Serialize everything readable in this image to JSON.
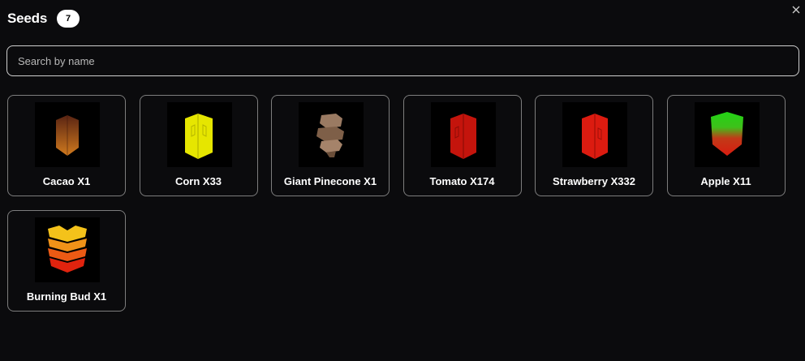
{
  "header": {
    "title": "Seeds",
    "count": "7"
  },
  "search": {
    "placeholder": "Search by name",
    "value": ""
  },
  "close_icon": "close-icon",
  "colors": {
    "background": "#0b0b0d",
    "card_border": "#7d7d7d",
    "badge_bg": "#ffffff"
  },
  "seeds": [
    {
      "label": "Cacao X1",
      "icon": "cacao-seed-icon"
    },
    {
      "label": "Corn X33",
      "icon": "corn-seed-icon"
    },
    {
      "label": "Giant Pinecone X1",
      "icon": "giant-pinecone-seed-icon"
    },
    {
      "label": "Tomato X174",
      "icon": "tomato-seed-icon"
    },
    {
      "label": "Strawberry X332",
      "icon": "strawberry-seed-icon"
    },
    {
      "label": "Apple X11",
      "icon": "apple-seed-icon"
    },
    {
      "label": "Burning Bud X1",
      "icon": "burning-bud-seed-icon"
    }
  ]
}
